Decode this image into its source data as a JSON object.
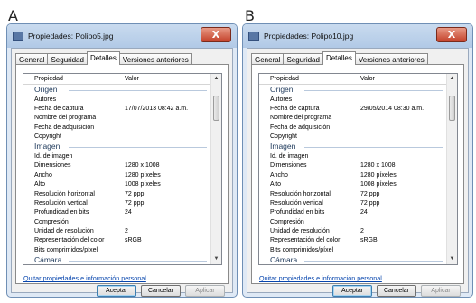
{
  "panels": [
    {
      "label": "A",
      "title": "Propiedades: Polipo5.jpg",
      "close_label": "X",
      "tabs": [
        "General",
        "Seguridad",
        "Detalles",
        "Versiones anteriores"
      ],
      "active_tab": 2,
      "header": {
        "property": "Propiedad",
        "value": "Valor"
      },
      "rows": [
        {
          "kind": "group",
          "label": "Origen"
        },
        {
          "kind": "item",
          "label": "Autores",
          "value": ""
        },
        {
          "kind": "item",
          "label": "Fecha de captura",
          "value": "17/07/2013 08:42 a.m."
        },
        {
          "kind": "item",
          "label": "Nombre del programa",
          "value": ""
        },
        {
          "kind": "item",
          "label": "Fecha de adquisición",
          "value": ""
        },
        {
          "kind": "item",
          "label": "Copyright",
          "value": ""
        },
        {
          "kind": "group",
          "label": "Imagen"
        },
        {
          "kind": "item",
          "label": "Id. de imagen",
          "value": ""
        },
        {
          "kind": "item",
          "label": "Dimensiones",
          "value": "1280 x 1008"
        },
        {
          "kind": "item",
          "label": "Ancho",
          "value": "1280 píxeles"
        },
        {
          "kind": "item",
          "label": "Alto",
          "value": "1008 píxeles"
        },
        {
          "kind": "item",
          "label": "Resolución horizontal",
          "value": "72 ppp"
        },
        {
          "kind": "item",
          "label": "Resolución vertical",
          "value": "72 ppp"
        },
        {
          "kind": "item",
          "label": "Profundidad en bits",
          "value": "24"
        },
        {
          "kind": "item",
          "label": "Compresión",
          "value": ""
        },
        {
          "kind": "item",
          "label": "Unidad de resolución",
          "value": "2"
        },
        {
          "kind": "item",
          "label": "Representación del color",
          "value": "sRGB"
        },
        {
          "kind": "item",
          "label": "Bits comprimidos/píxel",
          "value": ""
        },
        {
          "kind": "group",
          "label": "Cámara"
        }
      ],
      "link": "Quitar propiedades e información personal",
      "buttons": {
        "ok": "Aceptar",
        "cancel": "Cancelar",
        "apply": "Aplicar"
      }
    },
    {
      "label": "B",
      "title": "Propiedades: Polipo10.jpg",
      "close_label": "X",
      "tabs": [
        "General",
        "Seguridad",
        "Detalles",
        "Versiones anteriores"
      ],
      "active_tab": 2,
      "header": {
        "property": "Propiedad",
        "value": "Valor"
      },
      "rows": [
        {
          "kind": "group",
          "label": "Origen"
        },
        {
          "kind": "item",
          "label": "Autores",
          "value": ""
        },
        {
          "kind": "item",
          "label": "Fecha de captura",
          "value": "29/05/2014 08:30 a.m."
        },
        {
          "kind": "item",
          "label": "Nombre del programa",
          "value": ""
        },
        {
          "kind": "item",
          "label": "Fecha de adquisición",
          "value": ""
        },
        {
          "kind": "item",
          "label": "Copyright",
          "value": ""
        },
        {
          "kind": "group",
          "label": "Imagen"
        },
        {
          "kind": "item",
          "label": "Id. de imagen",
          "value": ""
        },
        {
          "kind": "item",
          "label": "Dimensiones",
          "value": "1280 x 1008"
        },
        {
          "kind": "item",
          "label": "Ancho",
          "value": "1280 píxeles"
        },
        {
          "kind": "item",
          "label": "Alto",
          "value": "1008 píxeles"
        },
        {
          "kind": "item",
          "label": "Resolución horizontal",
          "value": "72 ppp"
        },
        {
          "kind": "item",
          "label": "Resolución vertical",
          "value": "72 ppp"
        },
        {
          "kind": "item",
          "label": "Profundidad en bits",
          "value": "24"
        },
        {
          "kind": "item",
          "label": "Compresión",
          "value": ""
        },
        {
          "kind": "item",
          "label": "Unidad de resolución",
          "value": "2"
        },
        {
          "kind": "item",
          "label": "Representación del color",
          "value": "sRGB"
        },
        {
          "kind": "item",
          "label": "Bits comprimidos/píxel",
          "value": ""
        },
        {
          "kind": "group",
          "label": "Cámara"
        }
      ],
      "link": "Quitar propiedades e información personal",
      "buttons": {
        "ok": "Aceptar",
        "cancel": "Cancelar",
        "apply": "Aplicar"
      }
    }
  ]
}
